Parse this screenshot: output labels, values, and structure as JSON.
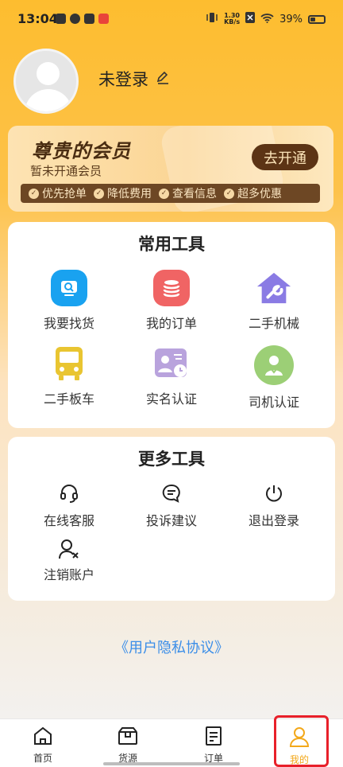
{
  "status_bar": {
    "time": "13:04",
    "net_speed_top": "1.30",
    "net_speed_bottom": "KB/s",
    "battery": "39%",
    "icons": [
      "vibrate-icon",
      "signal-off-icon",
      "wifi-icon",
      "battery-icon"
    ]
  },
  "profile": {
    "username": "未登录",
    "edit_icon": "edit-icon"
  },
  "vip": {
    "title": "尊贵的会员",
    "subtitle": "暂未开通会员",
    "open_button": "去开通",
    "perks": [
      "优先抢单",
      "降低费用",
      "查看信息",
      "超多优惠"
    ]
  },
  "common_tools": {
    "title": "常用工具",
    "items": [
      {
        "label": "我要找货",
        "icon": "search-goods-icon",
        "color": "#19a2f0"
      },
      {
        "label": "我的订单",
        "icon": "orders-icon",
        "color": "#f06464"
      },
      {
        "label": "二手机械",
        "icon": "machinery-icon",
        "color": "#8a7be4"
      },
      {
        "label": "二手板车",
        "icon": "bus-icon",
        "color": "#e9c531"
      },
      {
        "label": "实名认证",
        "icon": "id-card-icon",
        "color": "#b9a3dd"
      },
      {
        "label": "司机认证",
        "icon": "driver-icon",
        "color": "#9ccf76"
      }
    ]
  },
  "more_tools": {
    "title": "更多工具",
    "items": [
      {
        "label": "在线客服",
        "icon": "headset-icon"
      },
      {
        "label": "投诉建议",
        "icon": "chat-icon"
      },
      {
        "label": "退出登录",
        "icon": "power-icon"
      },
      {
        "label": "注销账户",
        "icon": "remove-user-icon"
      }
    ]
  },
  "privacy_link": "《用户隐私协议》",
  "tabbar": {
    "tabs": [
      {
        "label": "首页",
        "icon": "home-icon"
      },
      {
        "label": "货源",
        "icon": "goods-icon"
      },
      {
        "label": "订单",
        "icon": "order-icon"
      },
      {
        "label": "我的",
        "icon": "user-icon",
        "active": true
      }
    ],
    "active_color": "#f3a81a"
  }
}
